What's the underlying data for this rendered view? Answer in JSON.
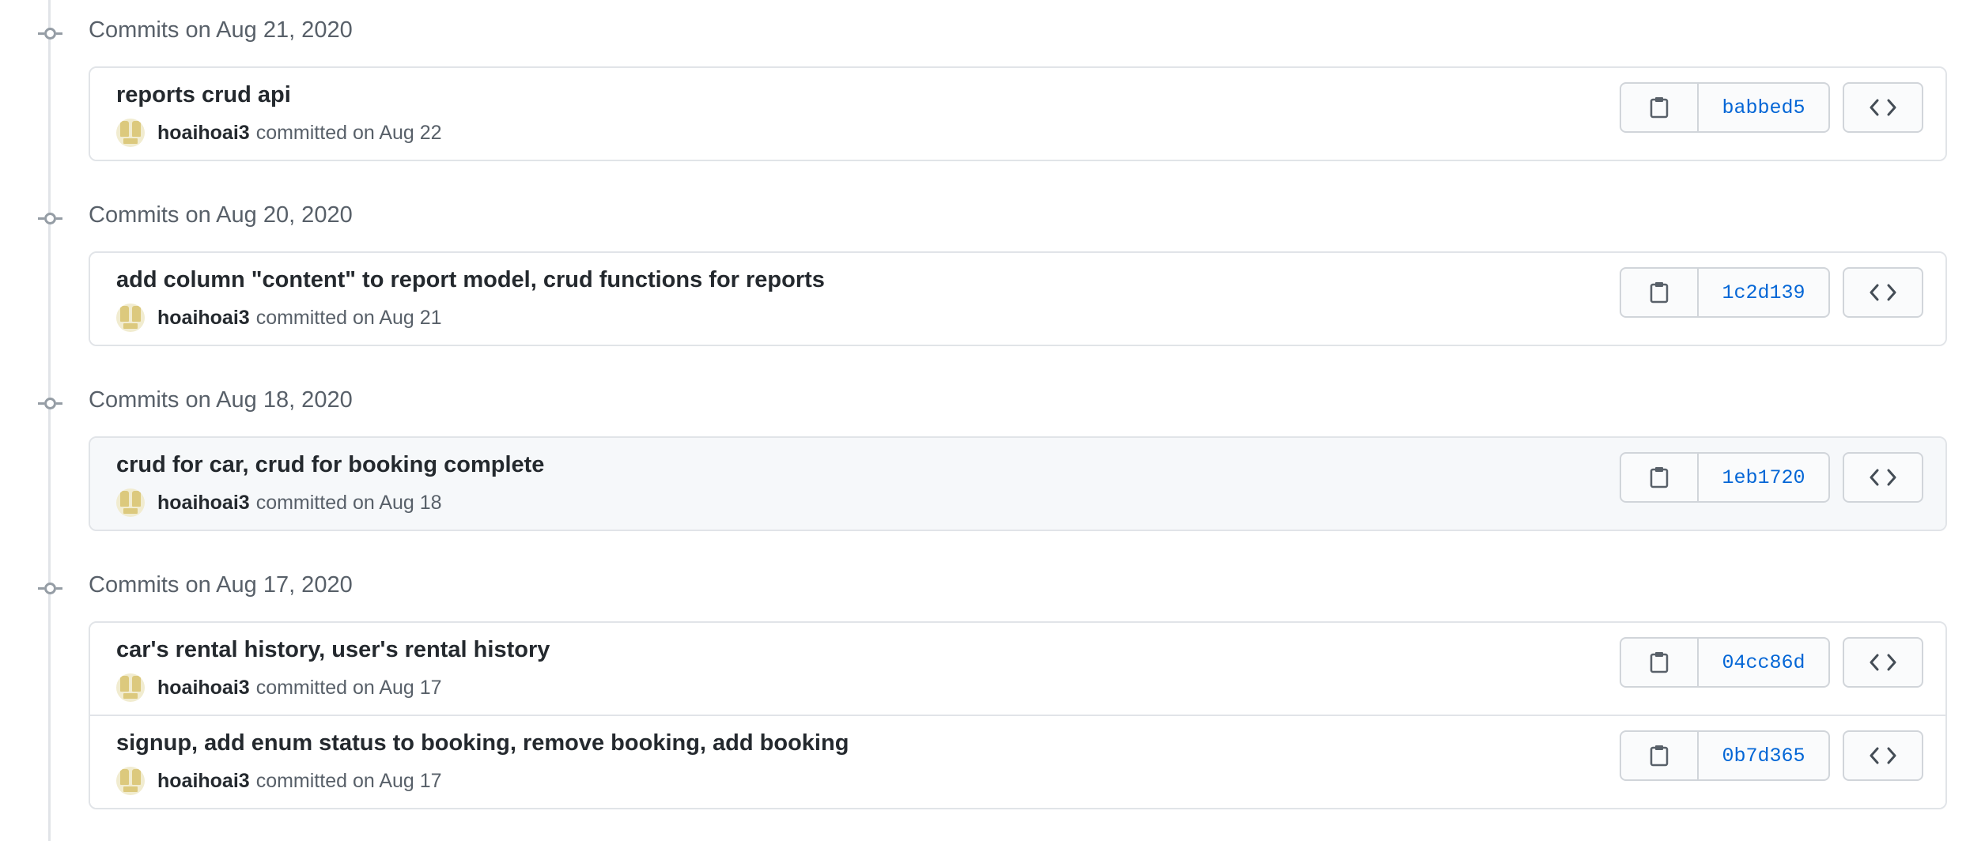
{
  "groups": [
    {
      "heading": "Commits on Aug 21, 2020",
      "commits": [
        {
          "title": "reports crud api",
          "author": "hoaihoai3",
          "date_text": "committed on Aug 22",
          "sha": "babbed5"
        }
      ]
    },
    {
      "heading": "Commits on Aug 20, 2020",
      "commits": [
        {
          "title": "add column \"content\" to report model, crud functions for reports",
          "author": "hoaihoai3",
          "date_text": "committed on Aug 21",
          "sha": "1c2d139"
        }
      ]
    },
    {
      "heading": "Commits on Aug 18, 2020",
      "commits": [
        {
          "title": "crud for car, crud for booking complete",
          "author": "hoaihoai3",
          "date_text": "committed on Aug 18",
          "sha": "1eb1720"
        }
      ]
    },
    {
      "heading": "Commits on Aug 17, 2020",
      "commits": [
        {
          "title": "car's rental history, user's rental history",
          "author": "hoaihoai3",
          "date_text": "committed on Aug 17",
          "sha": "04cc86d"
        },
        {
          "title": "signup, add enum status to booking, remove booking, add booking",
          "author": "hoaihoai3",
          "date_text": "committed on Aug 17",
          "sha": "0b7d365"
        }
      ]
    }
  ],
  "icons": {
    "copy": "clipboard-icon",
    "browse": "code-icon",
    "timeline": "git-commit-icon"
  },
  "colors": {
    "sha_link": "#0366d6",
    "highlight_row": "#f6f8fa",
    "border": "#e1e4e8"
  }
}
